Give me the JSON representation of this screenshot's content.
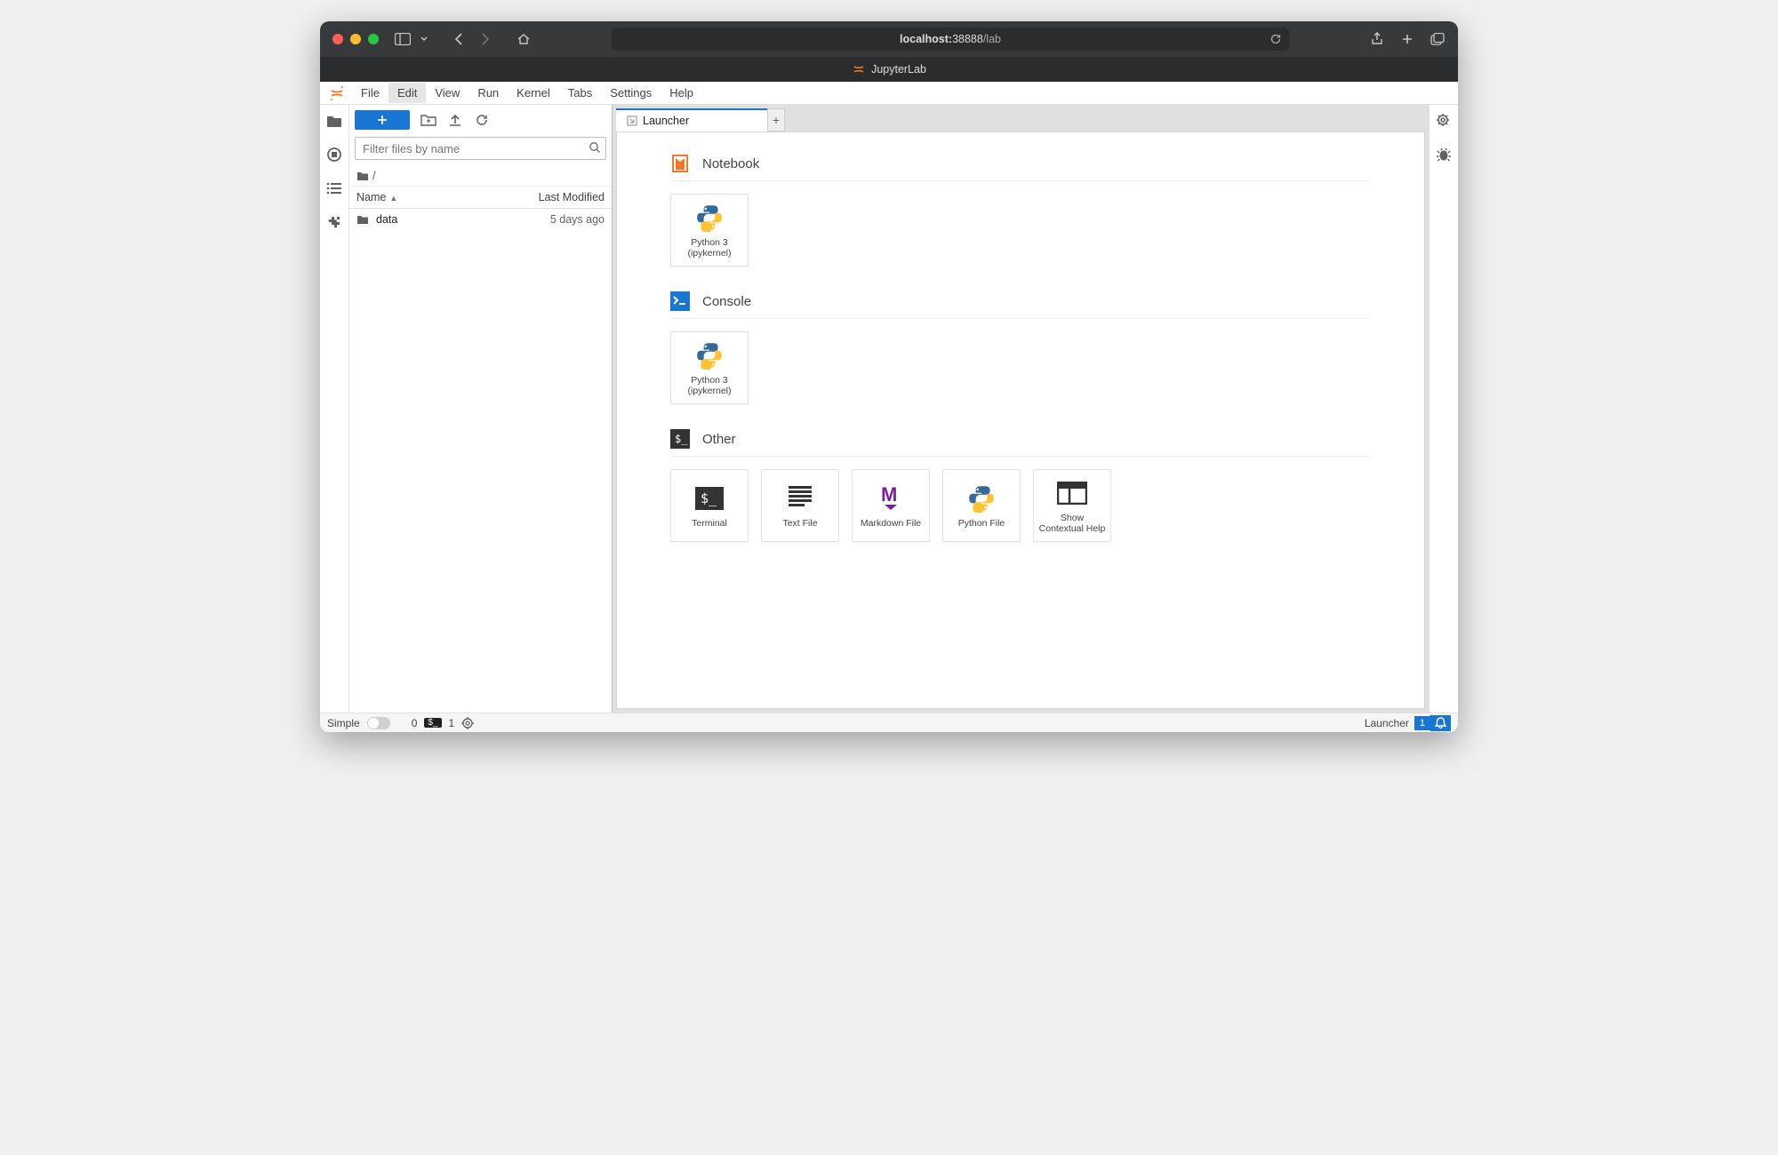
{
  "browser": {
    "url_display": "localhost:38888/lab",
    "url_prefix": "localhost:",
    "url_port": "38888",
    "url_path": "/lab",
    "tab_title": "JupyterLab"
  },
  "menubar": {
    "items": [
      "File",
      "Edit",
      "View",
      "Run",
      "Kernel",
      "Tabs",
      "Settings",
      "Help"
    ],
    "active_index": 1
  },
  "filebrowser": {
    "filter_placeholder": "Filter files by name",
    "breadcrumb": "/",
    "columns": {
      "name": "Name",
      "modified": "Last Modified"
    },
    "rows": [
      {
        "icon": "folder",
        "name": "data",
        "modified": "5 days ago"
      }
    ]
  },
  "dock": {
    "tab_label": "Launcher",
    "sections": [
      {
        "key": "notebook",
        "label": "Notebook",
        "icon": "notebook-section-icon",
        "cards": [
          {
            "icon": "python",
            "label": "Python 3\n(ipykernel)"
          }
        ]
      },
      {
        "key": "console",
        "label": "Console",
        "icon": "console-section-icon",
        "cards": [
          {
            "icon": "python",
            "label": "Python 3\n(ipykernel)"
          }
        ]
      },
      {
        "key": "other",
        "label": "Other",
        "icon": "terminal-section-icon",
        "cards": [
          {
            "icon": "terminal",
            "label": "Terminal"
          },
          {
            "icon": "textfile",
            "label": "Text File"
          },
          {
            "icon": "markdown",
            "label": "Markdown File"
          },
          {
            "icon": "python",
            "label": "Python File"
          },
          {
            "icon": "contextual",
            "label": "Show\nContextual Help"
          }
        ]
      }
    ]
  },
  "statusbar": {
    "simple_label": "Simple",
    "term_count": "0",
    "kernel_count": "1",
    "context": "Launcher",
    "notif_count": "1"
  }
}
